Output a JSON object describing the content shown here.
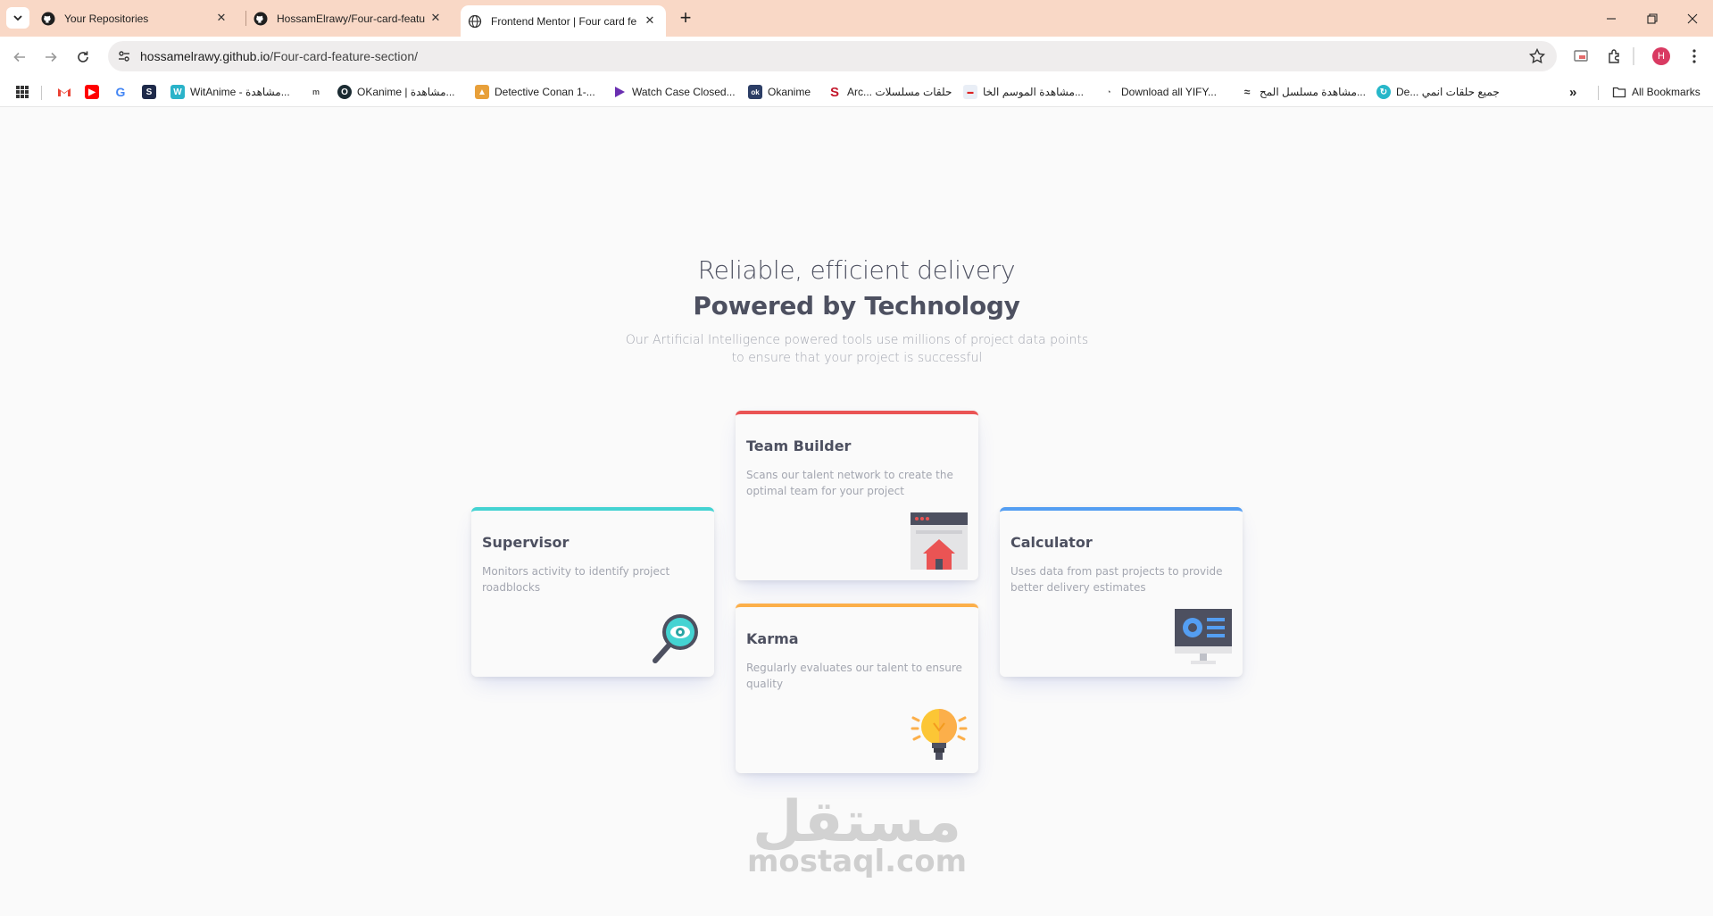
{
  "tabs": [
    {
      "title": "Your Repositories",
      "icon": "github-icon"
    },
    {
      "title": "HossamElrawy/Four-card-featu",
      "icon": "github-icon"
    },
    {
      "title": "Frontend Mentor | Four card fe",
      "icon": "globe-icon",
      "active": true
    }
  ],
  "address_bar": {
    "host": "hossamelrawy.github.io",
    "path": "/Four-card-feature-section/"
  },
  "profile_initial": "H",
  "bookmarks": [
    {
      "label": "",
      "icon": "gmail-icon"
    },
    {
      "label": "",
      "icon": "youtube-icon"
    },
    {
      "label": "",
      "icon": "google-icon"
    },
    {
      "label": "",
      "icon": "s-icon"
    },
    {
      "label": "WitAnime - مشاهدة...",
      "icon": "witanime-icon"
    },
    {
      "label": "",
      "icon": "mal-icon"
    },
    {
      "label": "OKanime | مشاهدة...",
      "icon": "okanime-icon"
    },
    {
      "label": "Detective Conan 1-...",
      "icon": "conan-icon"
    },
    {
      "label": "Watch Case Closed...",
      "icon": "play-icon"
    },
    {
      "label": "Okanime",
      "icon": "ok-icon"
    },
    {
      "label": "Arc... حلقات مسلسلات",
      "icon": "arc-icon"
    },
    {
      "label": "مشاهدة الموسم الخا...",
      "icon": "site-icon"
    },
    {
      "label": "Download all YIFY...",
      "icon": "yify-icon"
    },
    {
      "label": "مشاهدة مسلسل المح...",
      "icon": "bird-icon"
    },
    {
      "label": "De... جميع حلقات انمي",
      "icon": "de-icon"
    }
  ],
  "all_bookmarks_label": "All Bookmarks",
  "header": {
    "line1": "Reliable, efficient delivery",
    "line2": "Powered by Technology",
    "intro": "Our Artificial Intelligence powered tools use millions of project data points to ensure that your project is successful"
  },
  "cards": {
    "supervisor": {
      "title": "Supervisor",
      "text": "Monitors activity to identify project roadblocks",
      "accent": "#44d3d2",
      "icon": "magnifier-eye-icon"
    },
    "team_builder": {
      "title": "Team Builder",
      "text": "Scans our talent network to create the optimal team for your project",
      "accent": "#ea5454",
      "icon": "team-builder-icon"
    },
    "karma": {
      "title": "Karma",
      "text": "Regularly evaluates our talent to ensure quality",
      "accent": "#fcaf4a",
      "icon": "lightbulb-icon"
    },
    "calculator": {
      "title": "Calculator",
      "text": "Uses data from past projects to provide better delivery estimates",
      "accent": "#549ef2",
      "icon": "monitor-icon"
    }
  },
  "watermark": {
    "arabic": "مستقل",
    "latin": "mostaql.com"
  }
}
